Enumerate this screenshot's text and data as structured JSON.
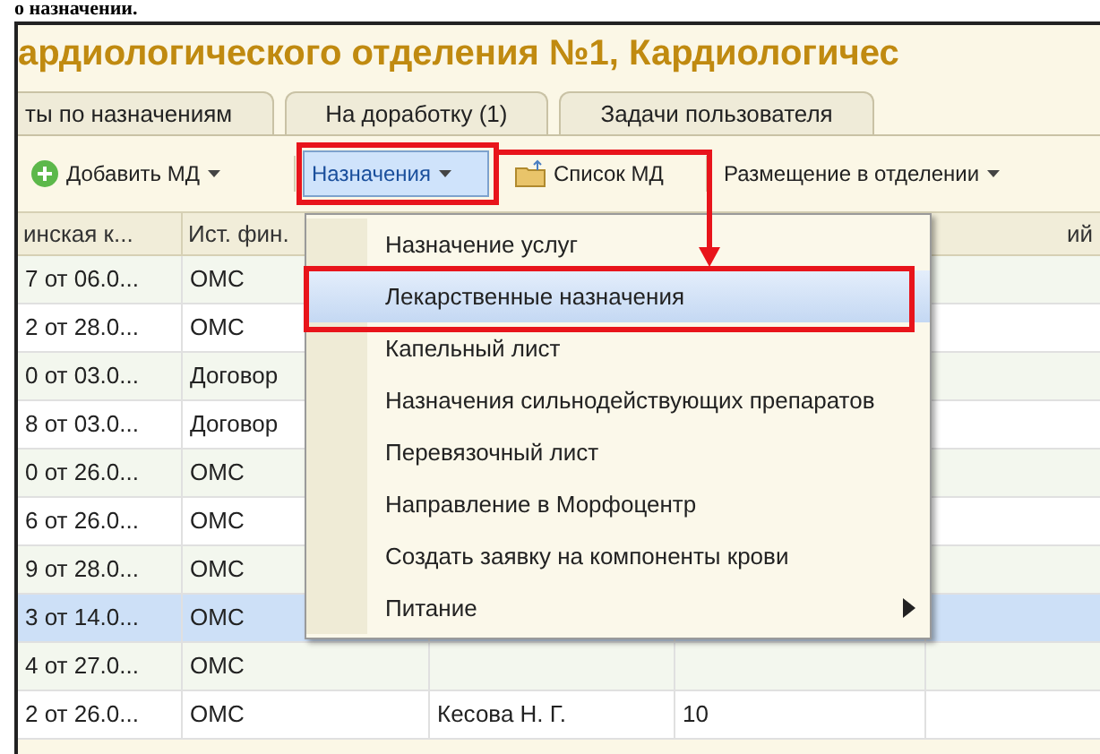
{
  "caption": "о назначении.",
  "window": {
    "title": "ардиологического отделения №1, Кардиологичес"
  },
  "tabs": [
    {
      "label": "ты по назначениям",
      "selected": false
    },
    {
      "label": "На доработку (1)",
      "selected": false
    },
    {
      "label": "Задачи пользователя",
      "selected": false
    }
  ],
  "toolbar": [
    {
      "kind": "add",
      "label": "Добавить МД",
      "pressed": false
    },
    {
      "kind": "dropdown",
      "label": "Назначения",
      "pressed": true
    },
    {
      "kind": "list",
      "label": "Список МД",
      "pressed": false
    },
    {
      "kind": "dropdown",
      "label": "Размещение в отделении",
      "pressed": false
    }
  ],
  "table": {
    "columns": [
      "инская к...",
      "Ист. фин."
    ],
    "column_5": "ий",
    "rows": [
      {
        "column_1": "7 от 06.0...",
        "column_2": "ОМС",
        "selected": false
      },
      {
        "column_1": "2 от 28.0...",
        "column_2": "ОМС",
        "selected": false
      },
      {
        "column_1": "0 от 03.0...",
        "column_2": "Договор",
        "selected": false
      },
      {
        "column_1": "8 от 03.0...",
        "column_2": "Договор",
        "selected": false
      },
      {
        "column_1": "0 от 26.0...",
        "column_2": "ОМС",
        "selected": false
      },
      {
        "column_1": "6 от 26.0...",
        "column_2": "ОМС",
        "selected": false
      },
      {
        "column_1": "9 от 28.0...",
        "column_2": "ОМС",
        "selected": false
      },
      {
        "column_1": "3 от 14.0...",
        "column_2": "ОМС",
        "selected": true
      },
      {
        "column_1": "4 от 27.0...",
        "column_2": "ОМС",
        "selected": false
      },
      {
        "column_1": "2 от 26.0...",
        "column_2": "ОМС",
        "column_3": "Кесова Н. Г.",
        "column_4": "10",
        "selected": false
      }
    ]
  },
  "menu": [
    {
      "label": "Назначение услуг",
      "selected": false,
      "submenu": false
    },
    {
      "label": "Лекарственные назначения",
      "selected": true,
      "submenu": false
    },
    {
      "label": "Капельный лист",
      "selected": false,
      "submenu": false
    },
    {
      "label": "Назначения сильнодействующих препаратов",
      "selected": false,
      "submenu": false
    },
    {
      "label": "Перевязочный лист",
      "selected": false,
      "submenu": false
    },
    {
      "label": "Направление в Морфоцентр",
      "selected": false,
      "submenu": false
    },
    {
      "label": "Создать заявку на компоненты крови",
      "selected": false,
      "submenu": false
    },
    {
      "label": "Питание",
      "selected": false,
      "submenu": true
    }
  ]
}
